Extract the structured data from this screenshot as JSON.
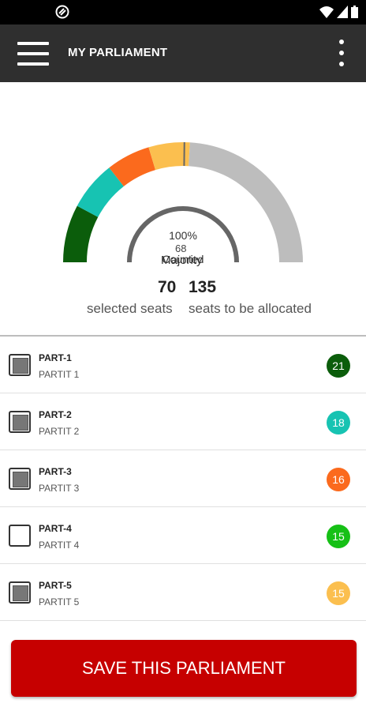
{
  "app_bar": {
    "title": "MY PARLIAMENT",
    "menu_icon": "hamburger-menu-icon",
    "more_icon": "more-vert-icon",
    "background": "#2f2f2f"
  },
  "status_bar": {
    "notification_icon": "vpn-key-icon",
    "icons": [
      "wifi-icon",
      "signal-icon",
      "battery-icon"
    ]
  },
  "parliament": {
    "majority_value": "68",
    "majority_label": "Majority",
    "counted_percent": "100%",
    "counted_label": "Counted",
    "selected_seats": "70",
    "selected_label": "selected seats",
    "allocated_seats": "135",
    "allocated_label": "seats to be allocated",
    "segments": [
      {
        "party": "PART-1",
        "seats": 21,
        "color": "#0b5d0b"
      },
      {
        "party": "PART-2",
        "seats": 18,
        "color": "#17c3b2"
      },
      {
        "party": "PART-3",
        "seats": 16,
        "color": "#fb6a1d"
      },
      {
        "party": "PART-5",
        "seats": 15,
        "color": "#fbbf4f"
      }
    ],
    "remainder_color": "#bdbdbd",
    "counted_arc_color": "#666666"
  },
  "parties": [
    {
      "code": "PART-1",
      "name": "PARTIT 1",
      "seats": "21",
      "checked": true,
      "color": "#0b5d0b"
    },
    {
      "code": "PART-2",
      "name": "PARTIT 2",
      "seats": "18",
      "checked": true,
      "color": "#17c3b2"
    },
    {
      "code": "PART-3",
      "name": "PARTIT 3",
      "seats": "16",
      "checked": true,
      "color": "#fb6a1d"
    },
    {
      "code": "PART-4",
      "name": "PARTIT 4",
      "seats": "15",
      "checked": false,
      "color": "#16c016"
    },
    {
      "code": "PART-5",
      "name": "PARTIT 5",
      "seats": "15",
      "checked": true,
      "color": "#fbbf4f"
    }
  ],
  "save_button": {
    "label": "SAVE THIS PARLIAMENT",
    "color": "#c60000"
  }
}
